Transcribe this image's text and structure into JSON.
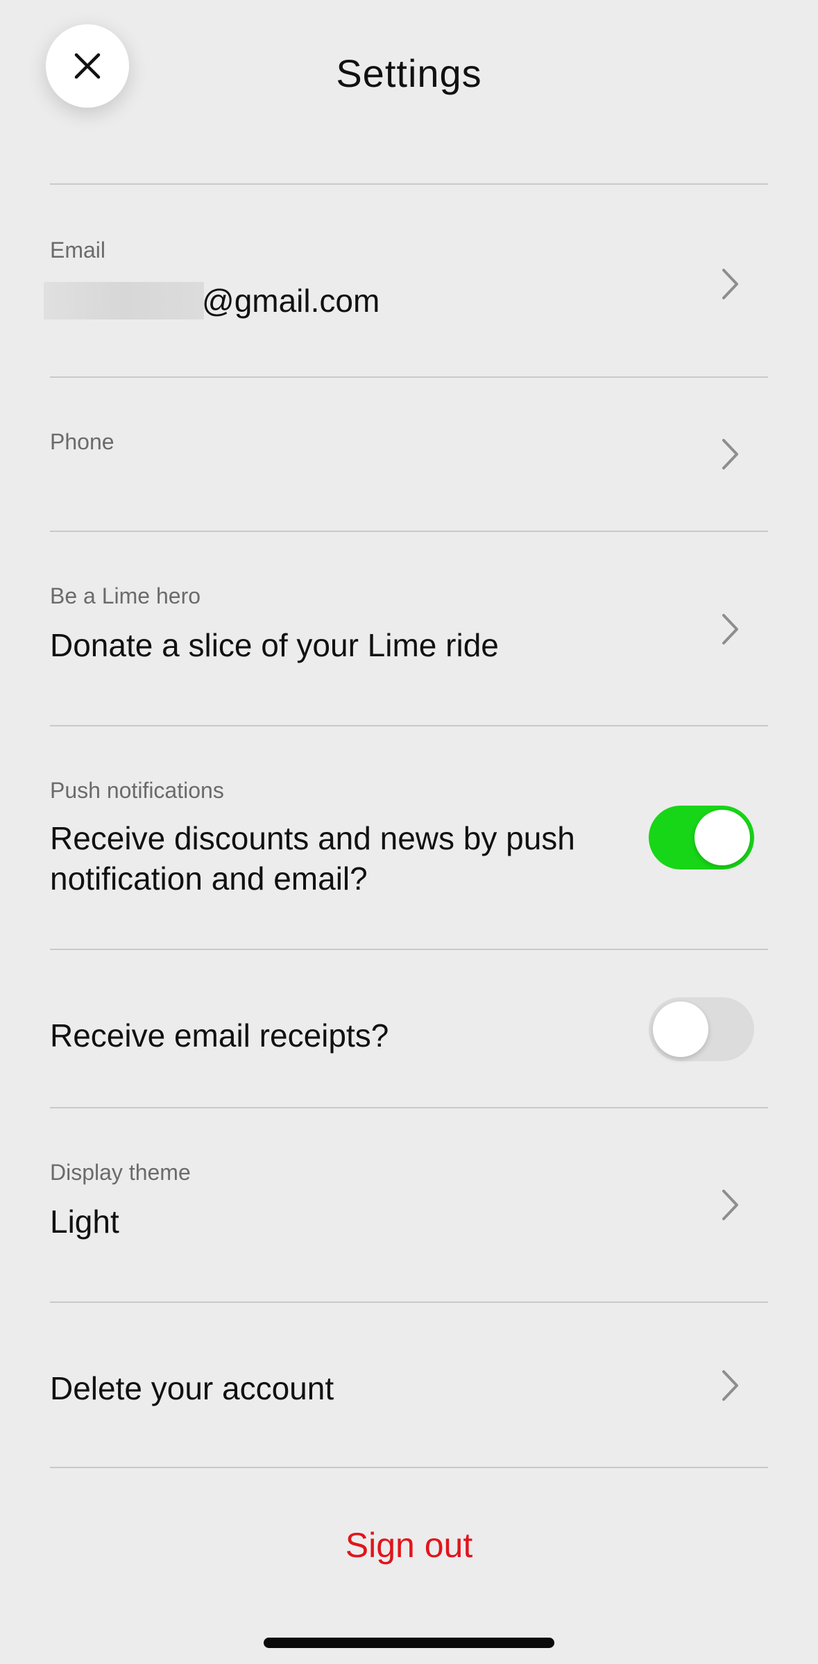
{
  "header": {
    "title": "Settings",
    "close_icon": "close-icon"
  },
  "rows": {
    "email": {
      "label": "Email",
      "value": "@gmail.com",
      "redacted": true
    },
    "phone": {
      "label": "Phone",
      "value": ""
    },
    "lime_hero": {
      "label": "Be a Lime hero",
      "value": "Donate a slice of your Lime ride"
    },
    "push_notifications": {
      "label": "Push notifications",
      "value": "Receive discounts and news by push notification and email?",
      "enabled": true
    },
    "email_receipts": {
      "value": "Receive email receipts?",
      "enabled": false
    },
    "display_theme": {
      "label": "Display theme",
      "value": "Light"
    },
    "delete_account": {
      "value": "Delete your account"
    }
  },
  "sign_out": {
    "label": "Sign out"
  },
  "colors": {
    "background": "#ececec",
    "toggle_on": "#17d617",
    "toggle_off": "#dcdcdc",
    "sign_out": "#e1141c"
  }
}
